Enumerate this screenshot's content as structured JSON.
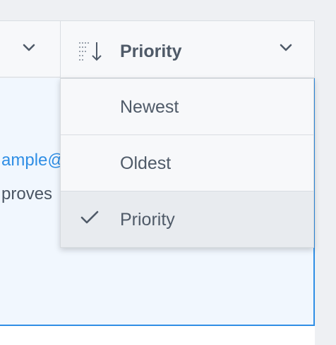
{
  "toolbar": {
    "left_dropdown_icon": "chevron-down-icon"
  },
  "sort": {
    "icon": "sort-descending-icon",
    "selected_label": "Priority",
    "chevron_icon": "chevron-down-icon"
  },
  "menu": {
    "items": [
      {
        "label": "Newest",
        "selected": false
      },
      {
        "label": "Oldest",
        "selected": false
      },
      {
        "label": "Priority",
        "selected": true
      }
    ],
    "check_icon": "checkmark-icon"
  },
  "content": {
    "email_fragment": "ample@",
    "text_fragment": "proves"
  },
  "colors": {
    "accent": "#2f8ee5",
    "text": "#4f5a68",
    "selected_bg": "#e8ebef"
  }
}
